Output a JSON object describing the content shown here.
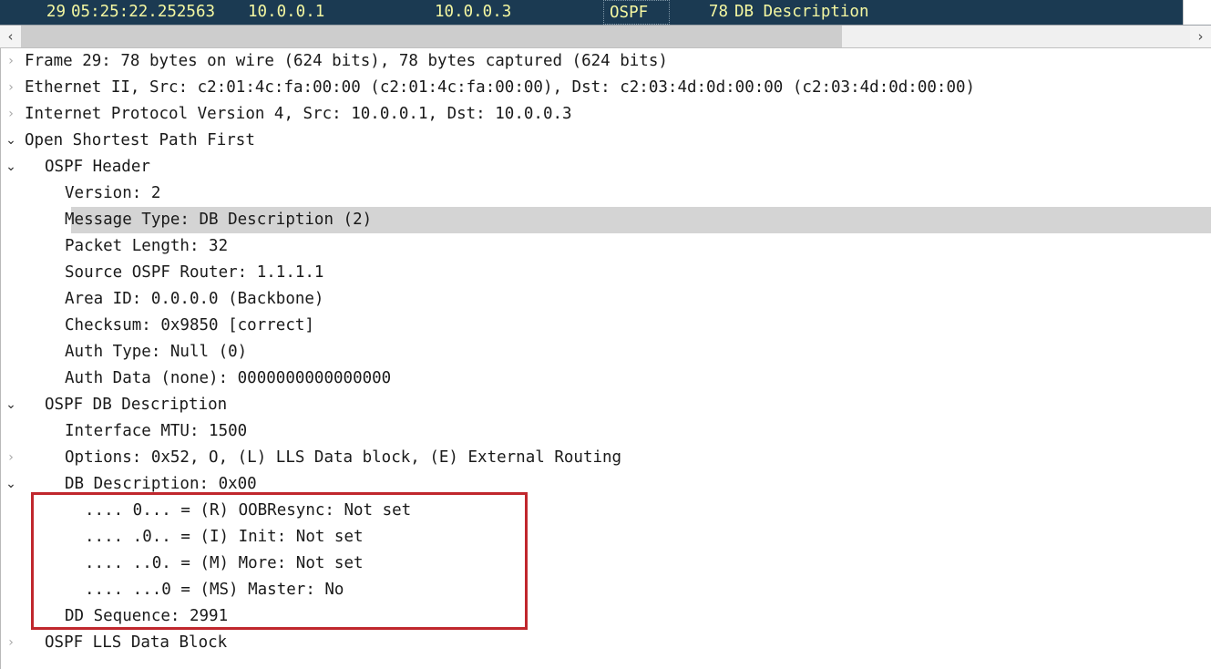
{
  "packet_list": {
    "selected_row": {
      "no": "29",
      "time": "05:25:22.252563",
      "source": "10.0.0.1",
      "destination": "10.0.0.3",
      "protocol": "OSPF",
      "length": "78",
      "info": "DB Description"
    },
    "colors": {
      "row_background": "#1b3a52",
      "row_text": "#f4f7a1"
    }
  },
  "hscrollbar": {
    "left_arrow": "‹",
    "right_arrow": "›"
  },
  "detail_tree": {
    "rows": [
      {
        "twisty": "collapsed",
        "indent": 0,
        "text": "Frame 29: 78 bytes on wire (624 bits), 78 bytes captured (624 bits)"
      },
      {
        "twisty": "collapsed",
        "indent": 0,
        "text": "Ethernet II, Src: c2:01:4c:fa:00:00 (c2:01:4c:fa:00:00), Dst: c2:03:4d:0d:00:00 (c2:03:4d:0d:00:00)"
      },
      {
        "twisty": "collapsed",
        "indent": 0,
        "text": "Internet Protocol Version 4, Src: 10.0.0.1, Dst: 10.0.0.3"
      },
      {
        "twisty": "expanded",
        "indent": 0,
        "text": "Open Shortest Path First"
      },
      {
        "twisty": "expanded",
        "indent": 1,
        "text": "OSPF Header"
      },
      {
        "twisty": "blank",
        "indent": 2,
        "text": "Version: 2"
      },
      {
        "twisty": "blank",
        "indent": 2,
        "text": "Message Type: DB Description (2)",
        "highlight": true
      },
      {
        "twisty": "blank",
        "indent": 2,
        "text": "Packet Length: 32"
      },
      {
        "twisty": "blank",
        "indent": 2,
        "text": "Source OSPF Router: 1.1.1.1"
      },
      {
        "twisty": "blank",
        "indent": 2,
        "text": "Area ID: 0.0.0.0 (Backbone)"
      },
      {
        "twisty": "blank",
        "indent": 2,
        "text": "Checksum: 0x9850 [correct]"
      },
      {
        "twisty": "blank",
        "indent": 2,
        "text": "Auth Type: Null (0)"
      },
      {
        "twisty": "blank",
        "indent": 2,
        "text": "Auth Data (none): 0000000000000000"
      },
      {
        "twisty": "expanded",
        "indent": 1,
        "text": "OSPF DB Description"
      },
      {
        "twisty": "blank",
        "indent": 2,
        "text": "Interface MTU: 1500"
      },
      {
        "twisty": "collapsed",
        "indent": 2,
        "text": "Options: 0x52, O, (L) LLS Data block, (E) External Routing"
      },
      {
        "twisty": "expanded",
        "indent": 2,
        "text": "DB Description: 0x00"
      },
      {
        "twisty": "blank",
        "indent": 3,
        "text": ".... 0... = (R) OOBResync: Not set"
      },
      {
        "twisty": "blank",
        "indent": 3,
        "text": ".... .0.. = (I) Init: Not set"
      },
      {
        "twisty": "blank",
        "indent": 3,
        "text": ".... ..0. = (M) More: Not set"
      },
      {
        "twisty": "blank",
        "indent": 3,
        "text": ".... ...0 = (MS) Master: No"
      },
      {
        "twisty": "blank",
        "indent": 2,
        "text": "DD Sequence: 2991"
      },
      {
        "twisty": "collapsed",
        "indent": 1,
        "text": "OSPF LLS Data Block"
      }
    ],
    "twisty_glyphs": {
      "collapsed": "›",
      "expanded": "⌄",
      "blank": " "
    }
  },
  "annotation": {
    "shape": "rectangle",
    "color": "#c0272d",
    "encloses": [
      ".... 0... = (R) OOBResync: Not set",
      ".... .0.. = (I) Init: Not set",
      ".... ..0. = (M) More: Not set",
      ".... ...0 = (MS) Master: No",
      "DD Sequence: 2991"
    ]
  }
}
